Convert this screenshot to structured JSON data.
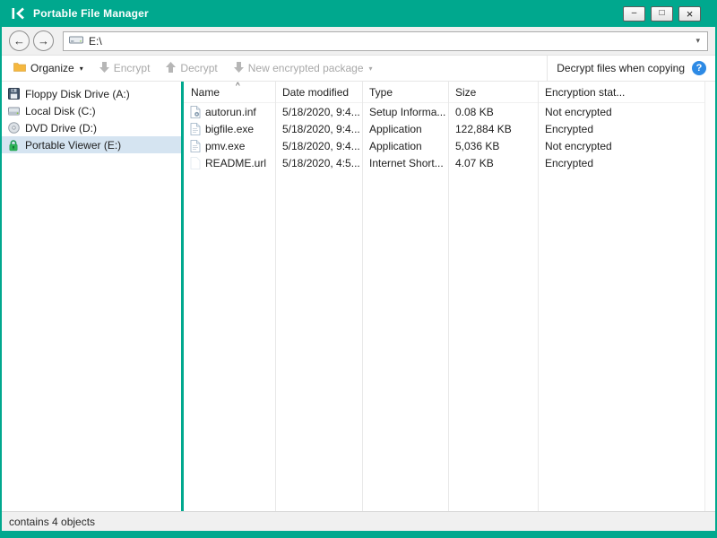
{
  "window": {
    "title": "Portable File Manager"
  },
  "colors": {
    "brand": "#00a88e",
    "help_blue": "#2d8ae5",
    "selection": "#d5e4f1",
    "disabled_text": "#a8a8a8"
  },
  "icons": {
    "minimize": "–",
    "maximize": "□",
    "close": "×",
    "back": "←",
    "forward": "→",
    "dropdown": "▾",
    "chevron_down": "▾",
    "sort": "^",
    "help": "?"
  },
  "navbar": {
    "address": "E:\\"
  },
  "toolbar": {
    "organize": "Organize",
    "encrypt": "Encrypt",
    "decrypt": "Decrypt",
    "new_package": "New encrypted package",
    "decrypt_when_copying": "Decrypt files when copying"
  },
  "sidebar": {
    "items": [
      {
        "label": "Floppy Disk Drive (A:)",
        "icon": "floppy-icon",
        "selected": false
      },
      {
        "label": "Local Disk (C:)",
        "icon": "hard-disk-icon",
        "selected": false
      },
      {
        "label": "DVD Drive (D:)",
        "icon": "dvd-icon",
        "selected": false
      },
      {
        "label": "Portable Viewer (E:)",
        "icon": "lock-icon",
        "selected": true
      }
    ]
  },
  "filelist": {
    "columns": [
      "Name",
      "Date modified",
      "Type",
      "Size",
      "Encryption stat..."
    ],
    "sort_column": "Name",
    "rows": [
      {
        "name": "autorun.inf",
        "date": "5/18/2020, 9:4...",
        "type": "Setup Informa...",
        "size": "0.08 KB",
        "encryption": "Not encrypted",
        "icon": "setup-file-icon"
      },
      {
        "name": "bigfile.exe",
        "date": "5/18/2020, 9:4...",
        "type": "Application",
        "size": "122,884 KB",
        "encryption": "Encrypted",
        "icon": "file-icon"
      },
      {
        "name": "pmv.exe",
        "date": "5/18/2020, 9:4...",
        "type": "Application",
        "size": "5,036 KB",
        "encryption": "Not encrypted",
        "icon": "file-icon"
      },
      {
        "name": "README.url",
        "date": "5/18/2020, 4:5...",
        "type": "Internet Short...",
        "size": "4.07 KB",
        "encryption": "Encrypted",
        "icon": "url-file-icon"
      }
    ]
  },
  "statusbar": {
    "text": "contains 4 objects"
  }
}
